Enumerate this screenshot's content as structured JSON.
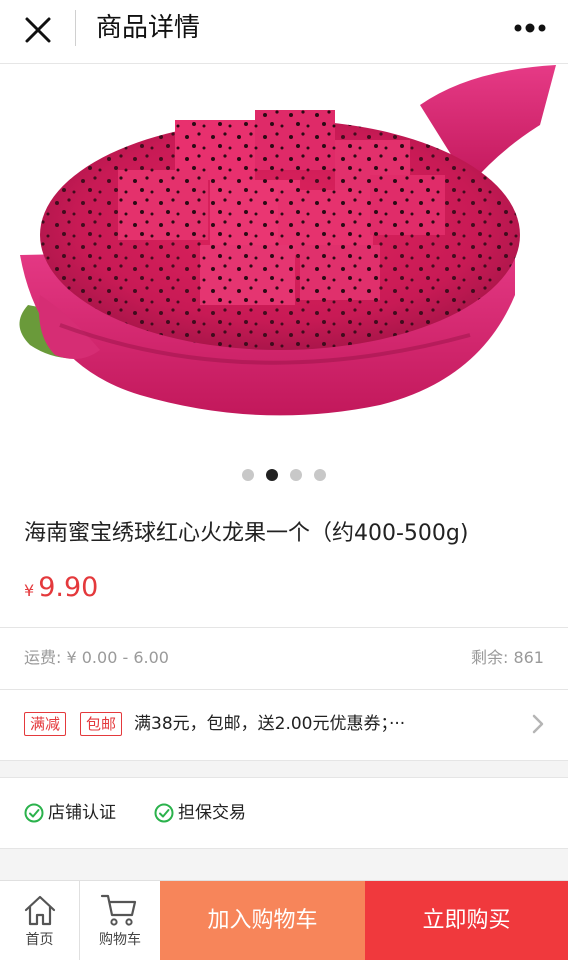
{
  "header": {
    "title": "商品详情",
    "close_icon": "close-icon",
    "more_icon": "more-dots-icon"
  },
  "gallery": {
    "image_subject": "halved red dragon fruit",
    "dots_total": 4,
    "active_dot": 2
  },
  "product": {
    "title": "海南蜜宝绣球红心火龙果一个（约400-500g)",
    "currency": "¥",
    "price": "9.90"
  },
  "meta": {
    "shipping": "运费: ¥ 0.00 - 6.00",
    "stock": "剩余: 861"
  },
  "promo": {
    "tags": [
      "满减",
      "包邮"
    ],
    "text": "满38元，包邮，送2.00元优惠券；···"
  },
  "guarantees": {
    "items": [
      "店铺认证",
      "担保交易"
    ]
  },
  "bottom_bar": {
    "home_label": "首页",
    "cart_label": "购物车",
    "add_cart_label": "加入购物车",
    "buy_now_label": "立即购买"
  },
  "colors": {
    "price_red": "#e4393c",
    "add_cart_orange": "#f7855a",
    "buy_now_red": "#f0393d",
    "check_green": "#2bb24c"
  }
}
